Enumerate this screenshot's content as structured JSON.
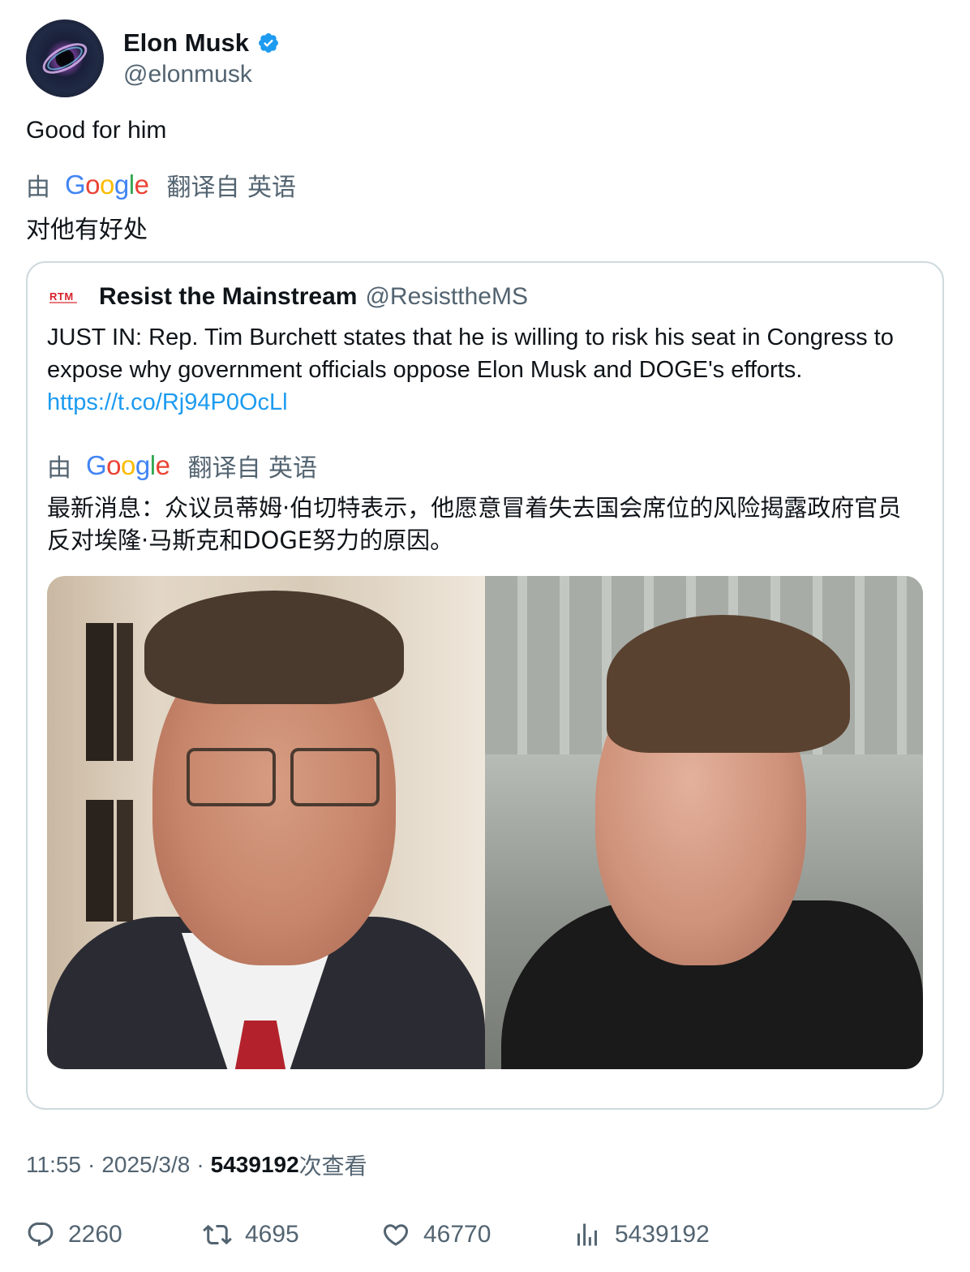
{
  "author": {
    "display_name": "Elon Musk",
    "handle": "@elonmusk",
    "verified_icon": "verified-badge-icon"
  },
  "tweet": {
    "text": "Good for him",
    "translation": {
      "by_label": "由",
      "google_label": "Google",
      "from_label": "翻译自 英语",
      "text": "对他有好处"
    }
  },
  "quote": {
    "logo_text": "RTM",
    "display_name": "Resist the Mainstream",
    "handle": "@ResisttheMS",
    "text": "JUST IN: Rep. Tim Burchett states that he is willing to risk his seat in Congress to expose why government officials oppose Elon Musk and DOGE's efforts.",
    "link": "https://t.co/Rj94P0OcLl",
    "translation": {
      "by_label": "由",
      "google_label": "Google",
      "from_label": "翻译自 英语",
      "text": "最新消息：众议员蒂姆·伯切特表示，他愿意冒着失去国会席位的风险揭露政府官员反对埃隆·马斯克和DOGE努力的原因。"
    }
  },
  "meta": {
    "time": "11:55",
    "sep": "·",
    "date": "2025/3/8",
    "views_count": "5439192",
    "views_label": "次查看"
  },
  "actions": {
    "replies": "2260",
    "retweets": "4695",
    "likes": "46770",
    "views": "5439192"
  },
  "colors": {
    "text": "#0f1419",
    "secondary": "#536471",
    "link": "#1d9bf0",
    "border": "#cfd9de",
    "verified": "#1d9bf0"
  }
}
